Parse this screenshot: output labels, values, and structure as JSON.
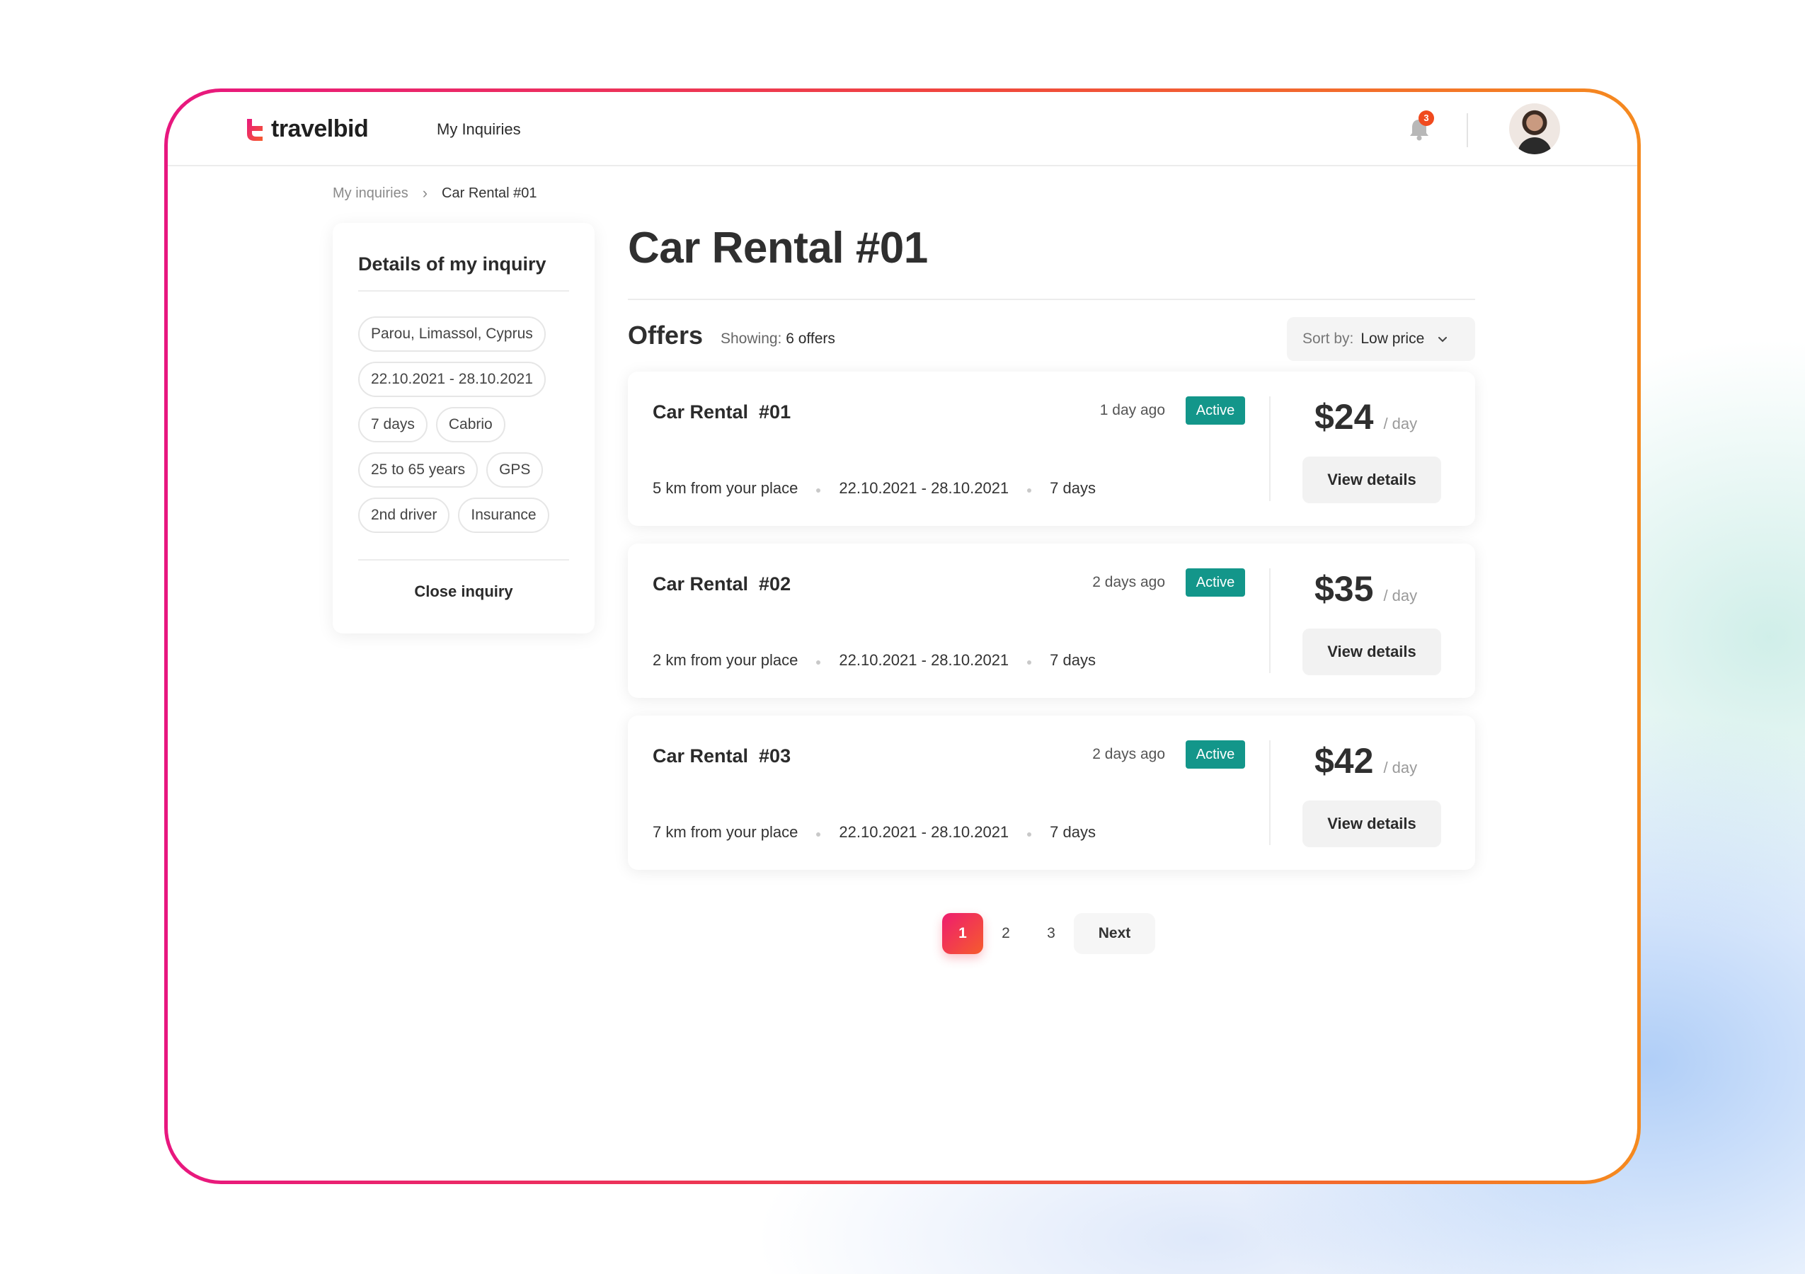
{
  "header": {
    "logo_text": "travelbid",
    "nav_link": "My Inquiries",
    "notification_count": "3"
  },
  "breadcrumb": {
    "parent": "My inquiries",
    "current": "Car Rental #01"
  },
  "sidebar": {
    "title": "Details of my inquiry",
    "chips": [
      "Parou, Limassol, Cyprus",
      "22.10.2021 - 28.10.2021",
      "7 days",
      "Cabrio",
      "25 to 65 years",
      "GPS",
      "2nd driver",
      "Insurance"
    ],
    "close_label": "Close inquiry"
  },
  "main": {
    "title": "Car Rental #01",
    "offers_title": "Offers",
    "showing_label": "Showing:",
    "showing_value": "6 offers",
    "sort_label": "Sort by:",
    "sort_value": "Low price"
  },
  "offers": [
    {
      "name": "Car Rental  #01",
      "time": "1 day ago",
      "status": "Active",
      "distance": "5 km from your place",
      "dates": "22.10.2021 - 28.10.2021",
      "duration": "7 days",
      "price": "$24",
      "unit": "/ day",
      "button": "View details"
    },
    {
      "name": "Car Rental  #02",
      "time": "2 days ago",
      "status": "Active",
      "distance": "2 km from your place",
      "dates": "22.10.2021 - 28.10.2021",
      "duration": "7 days",
      "price": "$35",
      "unit": "/ day",
      "button": "View details"
    },
    {
      "name": "Car Rental  #03",
      "time": "2 days ago",
      "status": "Active",
      "distance": "7 km from your place",
      "dates": "22.10.2021 - 28.10.2021",
      "duration": "7 days",
      "price": "$42",
      "unit": "/ day",
      "button": "View details"
    }
  ],
  "pagination": {
    "pages": [
      "1",
      "2",
      "3"
    ],
    "active": "1",
    "next_label": "Next"
  },
  "colors": {
    "brand_gradient_start": "#e8177f",
    "brand_gradient_end": "#f58a1f",
    "active_badge": "#13968a",
    "notification_badge": "#f04a1e"
  },
  "icons": [
    "travelbid-logo-icon",
    "bell-icon",
    "chevron-right-icon",
    "chevron-down-icon",
    "avatar"
  ]
}
